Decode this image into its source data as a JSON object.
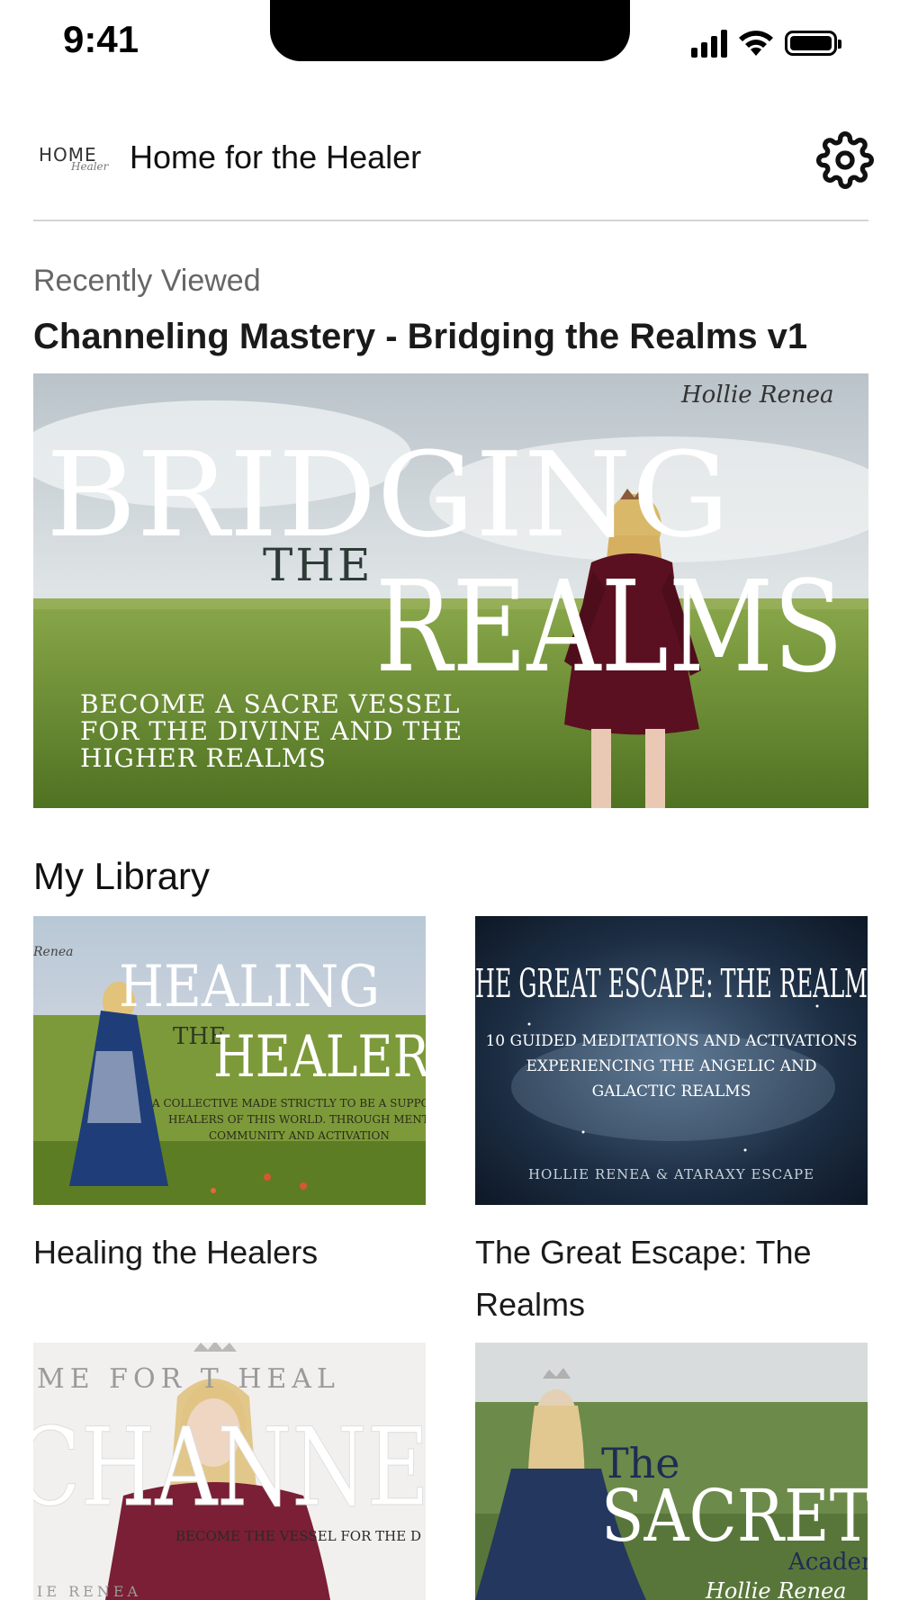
{
  "status_bar": {
    "time": "9:41",
    "icons": [
      "signal-icon",
      "wifi-icon",
      "battery-icon"
    ]
  },
  "header": {
    "logo_text": "HOME",
    "logo_script": "Healer",
    "title": "Home for the Healer",
    "settings_icon": "gear-icon"
  },
  "recently_viewed": {
    "label": "Recently Viewed",
    "title": "Channeling Mastery - Bridging the Realms v1",
    "image": {
      "signature": "Hollie Renea",
      "line1": "BRIDGING",
      "line2": "THE",
      "line3": "REALMS",
      "tagline": [
        "BECOME A SACRE VESSEL",
        "FOR THE DIVINE AND THE",
        "HIGHER REALMS"
      ]
    }
  },
  "library": {
    "heading": "My Library",
    "items": [
      {
        "title": "Healing the Healers",
        "image": {
          "corner": "Renea",
          "line1": "HEALING",
          "line2": "THE",
          "line3": "HEALER",
          "tagline": [
            "A COLLECTIVE MADE STRICTLY TO BE A SUPPORT FOR",
            "HEALERS OF THIS WORLD. THROUGH MENTORSHI",
            "COMMUNITY AND ACTIVATION"
          ]
        }
      },
      {
        "title": "The Great Escape: The Realms",
        "image": {
          "line1": "HE GREAT ESCAPE: THE REALM",
          "tagline": [
            "10 GUIDED MEDITATIONS AND ACTIVATIONS",
            "EXPERIENCING THE ANGELIC AND",
            "GALACTIC REALMS"
          ],
          "footer": "HOLLIE RENEA & ATARAXY ESCAPE"
        }
      },
      {
        "title": "",
        "image": {
          "top": "ME FOR    T HEAL",
          "line1": "CHANNE",
          "tagline": "BECOME THE VESSEL FOR THE D",
          "bottom": "IE RENEA"
        }
      },
      {
        "title": "",
        "image": {
          "line1": "The",
          "line2": "SACRET",
          "line3": "Acaden",
          "signature": "Hollie Renea"
        }
      }
    ]
  },
  "colors": {
    "divider": "#d4d4d4",
    "muted_text": "#666666",
    "accent_dress": "#5a1020",
    "grass": "#6e8f2c"
  }
}
